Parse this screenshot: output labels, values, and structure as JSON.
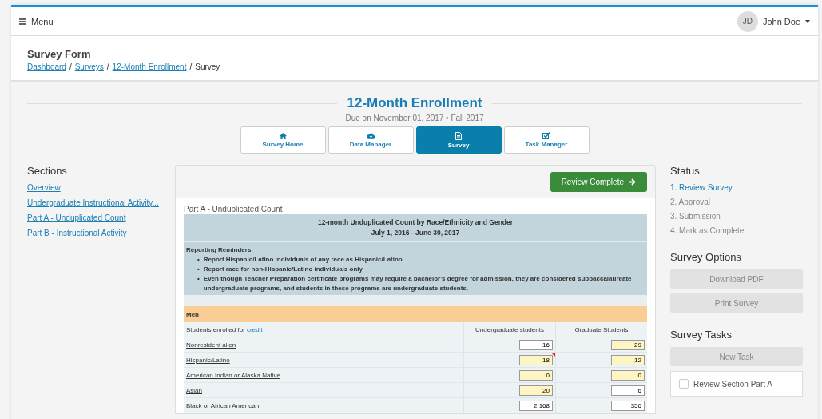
{
  "header": {
    "menu_label": "Menu",
    "user": {
      "initials": "JD",
      "name": "John Doe"
    }
  },
  "page": {
    "title": "Survey Form",
    "breadcrumb": [
      {
        "label": "Dashboard",
        "link": true
      },
      {
        "separator": "/",
        "label": "Surveys",
        "link": true
      },
      {
        "separator": "/",
        "label": "12-Month Enrollment",
        "link": true
      },
      {
        "separator": "/",
        "label": "Survey",
        "link": false
      }
    ]
  },
  "survey": {
    "title": "12-Month Enrollment",
    "due": "Due on November 01, 2017",
    "separator": "•",
    "term": "Fall 2017"
  },
  "tabs": [
    {
      "kind": "home",
      "label": "Survey Home",
      "selected": false
    },
    {
      "kind": "cloud",
      "label": "Data Manager",
      "selected": false
    },
    {
      "kind": "document",
      "label": "Survey",
      "selected": true
    },
    {
      "kind": "checklist",
      "label": "Task Manager",
      "selected": false
    }
  ],
  "sections": {
    "title": "Sections",
    "items": [
      "Overview",
      "Undergraduate Instructional Activity...",
      "Part A - Unduplicated Count",
      "Part B - Instructional Activity"
    ]
  },
  "form": {
    "action_button": "Review Complete",
    "part_title": "Part A - Unduplicated Count",
    "table_title": "12-month Unduplicated Count by Race/Ethnicity and Gender",
    "table_period": "July 1, 2016 - June 30, 2017",
    "reminders_title": "Reporting Reminders:",
    "reminders": [
      {
        "bullet": "•",
        "text": "Report Hispanic/Latino individuals of any race as Hispanic/Latino"
      },
      {
        "bullet": "•",
        "text": "Report race for non-Hispanic/Latino individuals only"
      },
      {
        "bullet": "•",
        "text": "Even though Teacher Preparation certificate programs may require a bachelor's degree for admission, they are considered subbaccalaureate undergraduate programs, and students in these programs are undergraduate students."
      }
    ],
    "group": "Men",
    "enrolled_text": "Students enrolled for ",
    "enrolled_link": "credit",
    "columns": [
      "Undergraduate students",
      "Graduate Students"
    ],
    "rows": [
      {
        "label": "Nonresident alien",
        "values": [
          {
            "value": "16",
            "highlighted": false,
            "flagged": false
          },
          {
            "value": "29",
            "highlighted": true,
            "flagged": false
          }
        ]
      },
      {
        "label": "Hispanic/Latino",
        "values": [
          {
            "value": "18",
            "highlighted": true,
            "flagged": true
          },
          {
            "value": "12",
            "highlighted": true,
            "flagged": false
          }
        ]
      },
      {
        "label": "American Indian or Alaska Native",
        "values": [
          {
            "value": "0",
            "highlighted": true,
            "flagged": false
          },
          {
            "value": "0",
            "highlighted": true,
            "flagged": false
          }
        ]
      },
      {
        "label": "Asian",
        "values": [
          {
            "value": "20",
            "highlighted": true,
            "flagged": false
          },
          {
            "value": "6",
            "highlighted": false,
            "flagged": false
          }
        ]
      },
      {
        "label": "Black or African American",
        "values": [
          {
            "value": "2,168",
            "highlighted": false,
            "flagged": false
          },
          {
            "value": "356",
            "highlighted": false,
            "flagged": false
          }
        ]
      }
    ]
  },
  "status": {
    "title": "Status",
    "steps": [
      {
        "label": "1. Review Survey",
        "current": true
      },
      {
        "label": "2. Approval",
        "current": false
      },
      {
        "label": "3. Submission",
        "current": false
      },
      {
        "label": "4. Mark as Complete",
        "current": false
      }
    ]
  },
  "options": {
    "title": "Survey Options",
    "buttons": [
      "Download PDF",
      "Print Survey"
    ]
  },
  "tasks": {
    "title": "Survey Tasks",
    "new_button": "New Task",
    "items": [
      {
        "label": "Review Section Part A",
        "checked": false
      }
    ]
  }
}
